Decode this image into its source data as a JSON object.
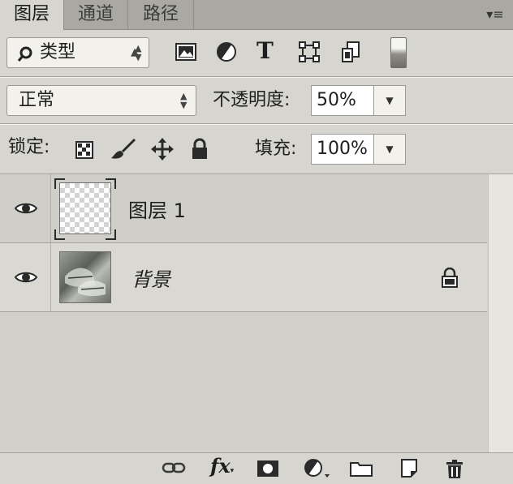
{
  "tabs": [
    "图层",
    "通道",
    "路径"
  ],
  "panel_menu_icon": "panel-menu-icon",
  "filter": {
    "kind_label": "类型",
    "icons": [
      "image-filter-icon",
      "adjustment-filter-icon",
      "type-filter-icon",
      "shape-filter-icon",
      "smart-object-filter-icon",
      "filter-toggle-icon"
    ]
  },
  "blend": {
    "mode": "正常",
    "opacity_label": "不透明度:",
    "opacity_value": "50%"
  },
  "lock": {
    "label": "锁定:",
    "icons": [
      "lock-transparent-pixels-icon",
      "lock-image-pixels-icon",
      "lock-position-icon",
      "lock-all-icon"
    ],
    "fill_label": "填充:",
    "fill_value": "100%"
  },
  "layers": [
    {
      "name": "图层 1",
      "visible": true,
      "locked": false,
      "selected": true
    },
    {
      "name": "背景",
      "visible": true,
      "locked": true,
      "selected": false
    }
  ],
  "bottom_icons": [
    "link-layers-icon",
    "layer-style-fx-icon",
    "add-mask-icon",
    "adjustment-layer-icon",
    "group-folder-icon",
    "new-layer-icon",
    "delete-trash-icon"
  ],
  "colors": {
    "panel_bg": "#d6d5cf",
    "tab_bg": "#a9a8a3",
    "field_bg": "#ffffff"
  }
}
